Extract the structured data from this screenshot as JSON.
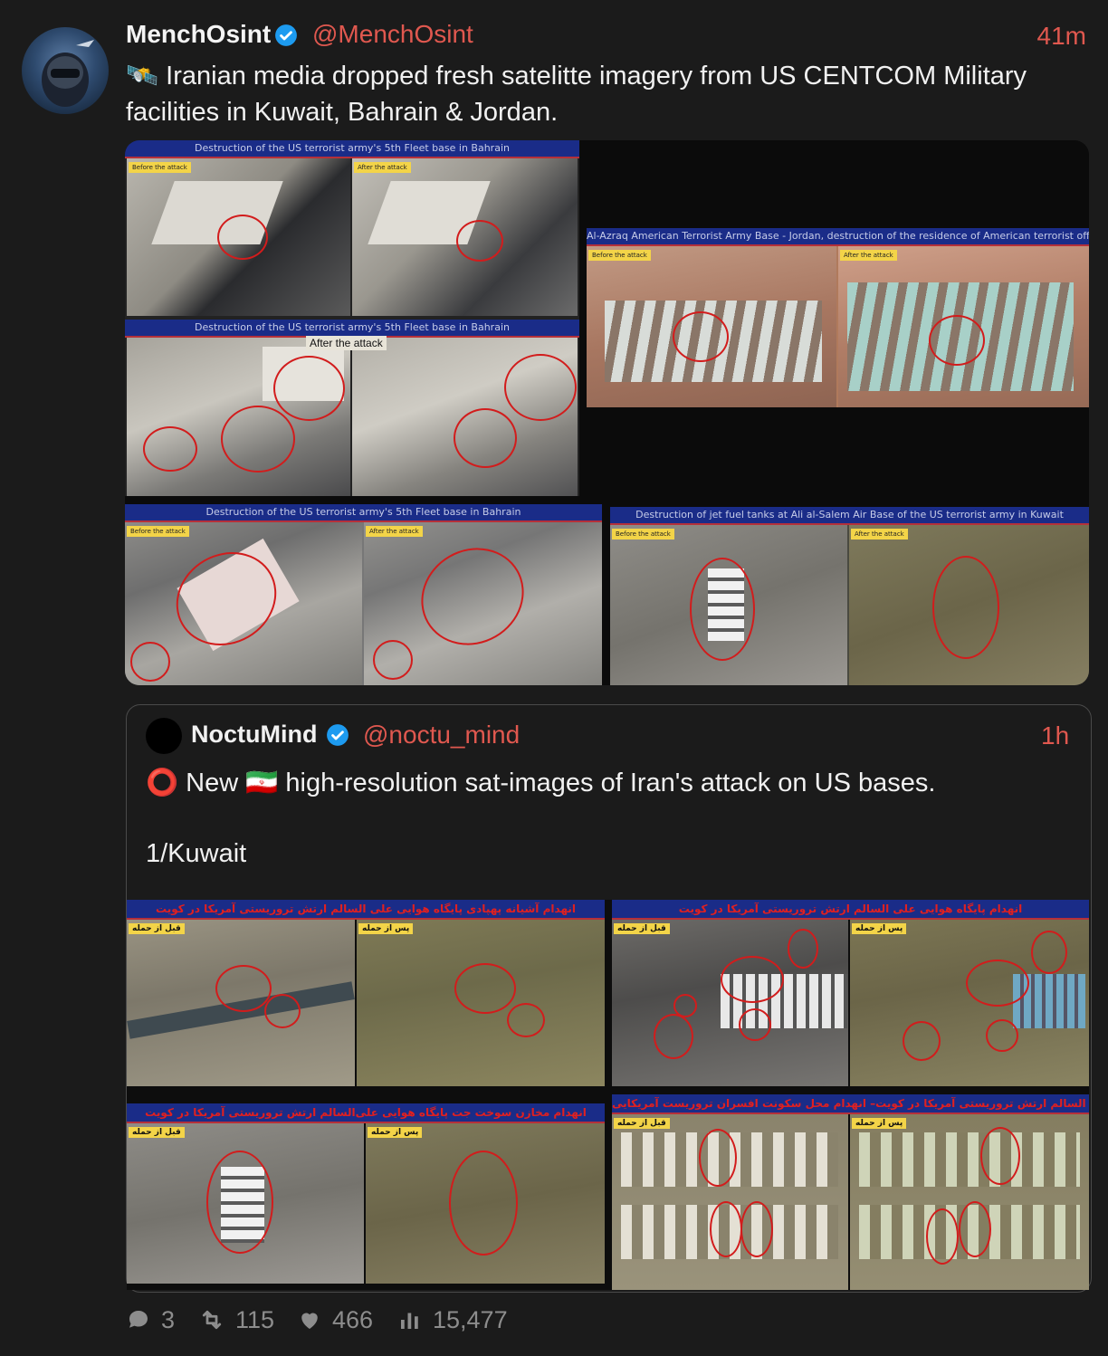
{
  "tweet": {
    "display_name": "MenchOsint",
    "handle": "@MenchOsint",
    "time": "41m",
    "text_line1": "🛰️ Iranian media dropped fresh satelitte imagery from US CENTCOM Military",
    "text_line2": "facilities in Kuwait, Bahrain & Jordan."
  },
  "media": {
    "img1_title": "Destruction of the US terrorist army's 5th Fleet base in Bahrain",
    "img1_before": "Before the attack",
    "img1_after": "After the attack",
    "img1b_title": "Destruction of the US terrorist army's 5th Fleet base in Bahrain",
    "img1b_overlay": "After the attack",
    "img2_title": "Al-Azraq American Terrorist Army Base - Jordan, destruction of the residence of American terrorist officers",
    "img3_title": "Destruction of the US terrorist army's 5th Fleet base in Bahrain",
    "img4_title": "Destruction of jet fuel tanks at Ali al-Salem Air Base of the US terrorist army in Kuwait",
    "before_label": "Before the attack",
    "after_label": "After the attack"
  },
  "quote": {
    "display_name": "NoctuMind",
    "handle": "@noctu_mind",
    "time": "1h",
    "text_line1": "⭕ New 🇮🇷 high-resolution sat-images of Iran's attack on US bases.",
    "text_line2": "1/Kuwait",
    "q1_title": "انهدام آشیانه پهپادی پایگاه هوایی علی السالم ارتش تروریستی آمریکا در کویت",
    "q2_title": "انهدام پایگاه هوایی علی السالم ارتش تروریستی آمریکا در کویت",
    "q3_title": "انهدام مخازن سوخت جت پایگاه هوایی علی‌السالم ارتش تروریستی آمریکا در کویت",
    "q4_title": "پایگاه هوایی علی السالم ارتش تروریستی آمریکا در کویت– انهدام محل سکونت افسران تروریست آمریکایی",
    "before_fa": "قبل از حمله",
    "after_fa": "پس از حمله"
  },
  "actions": {
    "replies": "3",
    "retweets": "115",
    "likes": "466",
    "views": "15,477"
  },
  "colors": {
    "accent": "#e0584f",
    "verified": "#1d9bf0",
    "background": "#1b1b1b"
  }
}
